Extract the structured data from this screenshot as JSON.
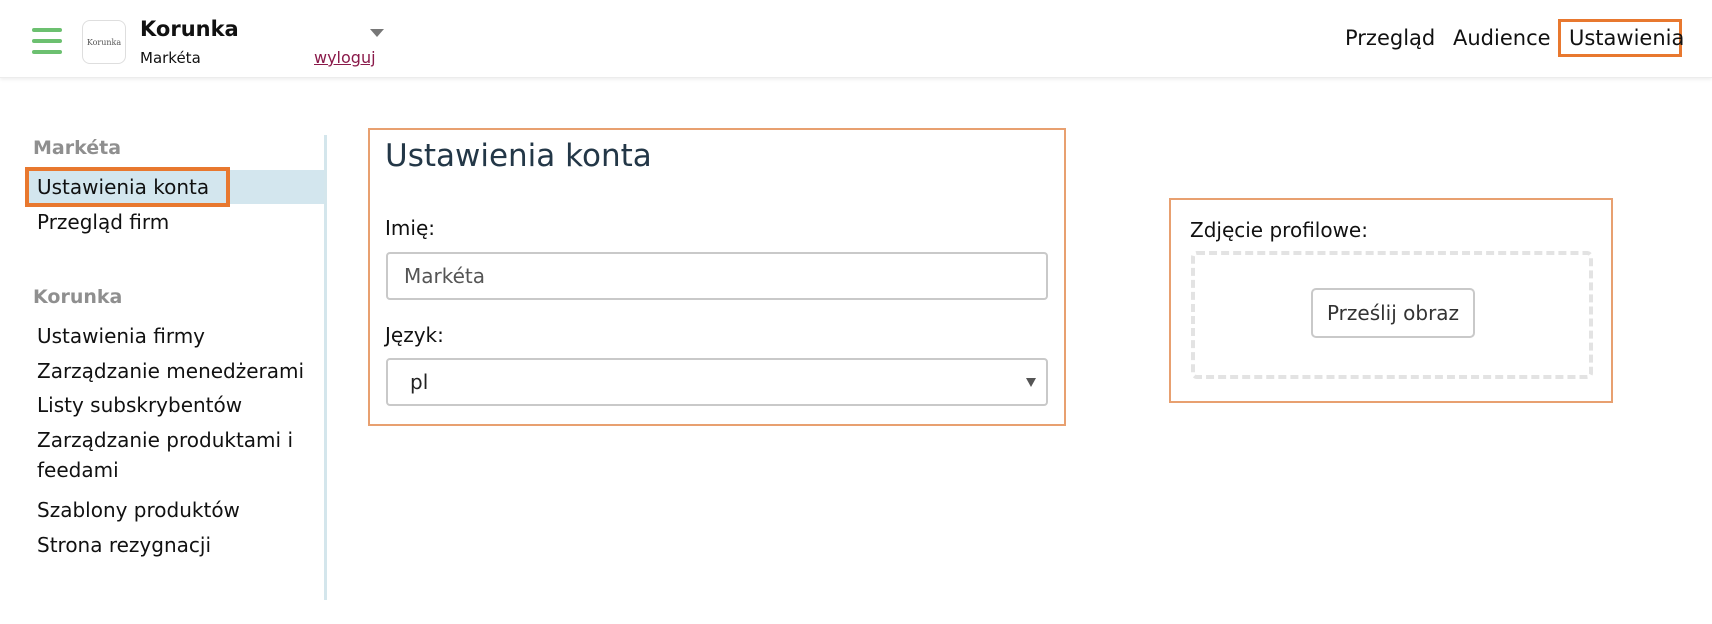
{
  "header": {
    "logo_text": "Korunka",
    "organization": "Korunka",
    "user": "Markéta",
    "logout": "wyloguj",
    "nav": {
      "overview": "Przegląd",
      "audience": "Audience",
      "settings": "Ustawienia"
    }
  },
  "sidebar": {
    "user_heading": "Markéta",
    "user_items": [
      {
        "label": "Ustawienia konta",
        "active": true
      },
      {
        "label": "Przegląd firm",
        "active": false
      }
    ],
    "company_heading": "Korunka",
    "company_items": [
      {
        "label": "Ustawienia firmy"
      },
      {
        "label": "Zarządzanie menedżerami"
      },
      {
        "label": "Listy subskrybentów"
      },
      {
        "label": "Zarządzanie produktami i feedami"
      },
      {
        "label": "Szablony produktów"
      },
      {
        "label": "Strona rezygnacji"
      }
    ]
  },
  "account": {
    "title": "Ustawienia konta",
    "name_label": "Imię:",
    "name_value": "Markéta",
    "language_label": "Język:",
    "language_value": "pl"
  },
  "photo": {
    "label": "Zdjęcie profilowe:",
    "upload_button": "Prześlij obraz"
  },
  "colors": {
    "accent_highlight": "#e8782f",
    "menu_green": "#6cc070",
    "active_bg": "#d3e6ee",
    "logout_link": "#8a1a4a"
  }
}
